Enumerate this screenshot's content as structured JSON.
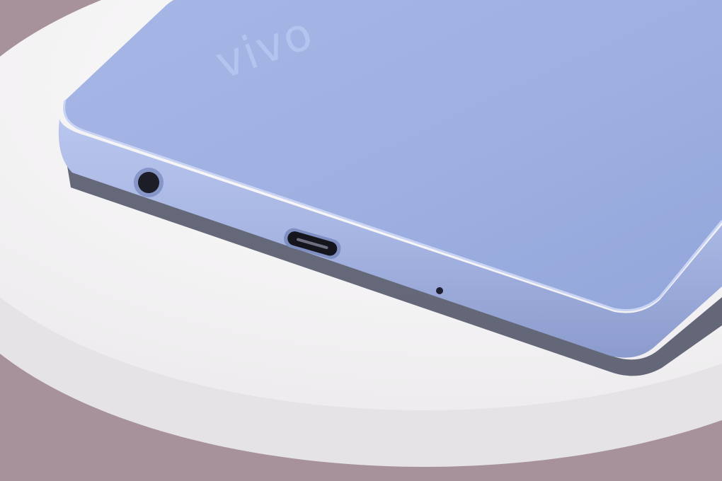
{
  "scene": {
    "subject": "phone-bottom-edge-on-pedestal",
    "brand_logo": "vivo",
    "colors": {
      "background": "#a7929c",
      "pedestal": "#f4f3f4",
      "phone_back": "#9fb1e2",
      "phone_edge": "#a9b8e4"
    }
  }
}
